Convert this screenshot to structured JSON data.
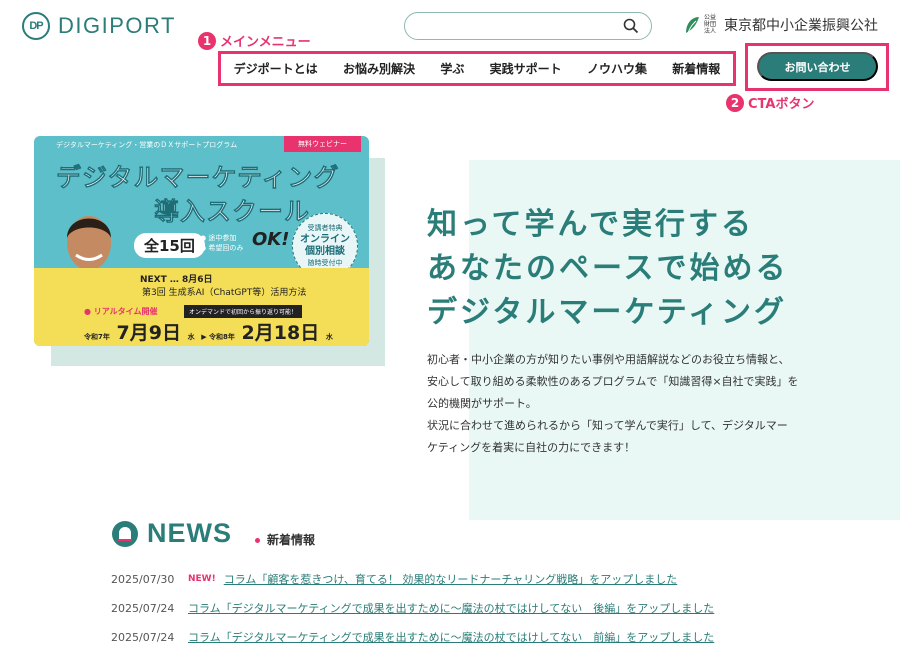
{
  "header": {
    "logo_mark": "DP",
    "logo_text": "DIGIPORT",
    "search_placeholder": "",
    "org_small": "公益財団法人",
    "org_name": "東京都中小企業振興公社"
  },
  "annotations": {
    "menu_num": "1",
    "menu_label": "メインメニュー",
    "cta_num": "2",
    "cta_label": "CTAボタン",
    "color": "#e8336f"
  },
  "nav": {
    "items": [
      "デジポートとは",
      "お悩み別解決",
      "学ぶ",
      "実践サポート",
      "ノウハウ集",
      "新着情報"
    ]
  },
  "cta": {
    "label": "お問い合わせ",
    "color": "#2a7d78"
  },
  "banner": {
    "top_text": "デジタルマーケティング・営業のＤＸサポートプログラム",
    "tag": "無料ウェビナー",
    "title_line1": "デジタルマーケティング",
    "title_line2": "導入スクール",
    "count": "全15回",
    "bullet1": "● 途中参加",
    "bullet2": "● 希望回のみ",
    "ok": "OK!",
    "badge_top": "受講者特典",
    "badge_main1": "オンライン",
    "badge_main2": "個別相談",
    "badge_bottom": "随時受付中",
    "next": "NEXT … 8月6日",
    "session": "第3回 生成系AI（ChatGPT等）活用方法",
    "live": "● リアルタイム開催",
    "ondemand": "オンデマンドで初回から振り返り可能！",
    "date_from_era": "令和7年",
    "date_from": "7月9日",
    "date_from_dow": "水",
    "date_to_era": "令和8年",
    "date_to": "2月18日",
    "date_to_dow": "水"
  },
  "hero": {
    "headline_line1": "知って学んで実行する",
    "headline_line2": "あなたのペースで始める",
    "headline_line3": "デジタルマーケティング",
    "desc_line1": "初心者・中小企業の方が知りたい事例や用語解説などのお役立ち情報と、",
    "desc_line2": "安心して取り組める柔軟性のあるプログラムで「知識習得×自社で実践」を",
    "desc_line3": "公的機関がサポート。",
    "desc_line4": "状況に合わせて進められるから「知って学んで実行」して、デジタルマー",
    "desc_line5": "ケティングを着実に自社の力にできます！"
  },
  "news": {
    "title": "NEWS",
    "subtitle": "新着情報",
    "items": [
      {
        "date": "2025/07/30",
        "new": "NEW!",
        "text": "コラム「顧客を惹きつけ、育てる！ 効果的なリードナーチャリング戦略」をアップしました"
      },
      {
        "date": "2025/07/24",
        "new": "",
        "text": "コラム「デジタルマーケティングで成果を出すために〜魔法の杖ではけしてない　後編」をアップしました"
      },
      {
        "date": "2025/07/24",
        "new": "",
        "text": "コラム「デジタルマーケティングで成果を出すために〜魔法の杖ではけしてない　前編」をアップしました"
      }
    ]
  }
}
